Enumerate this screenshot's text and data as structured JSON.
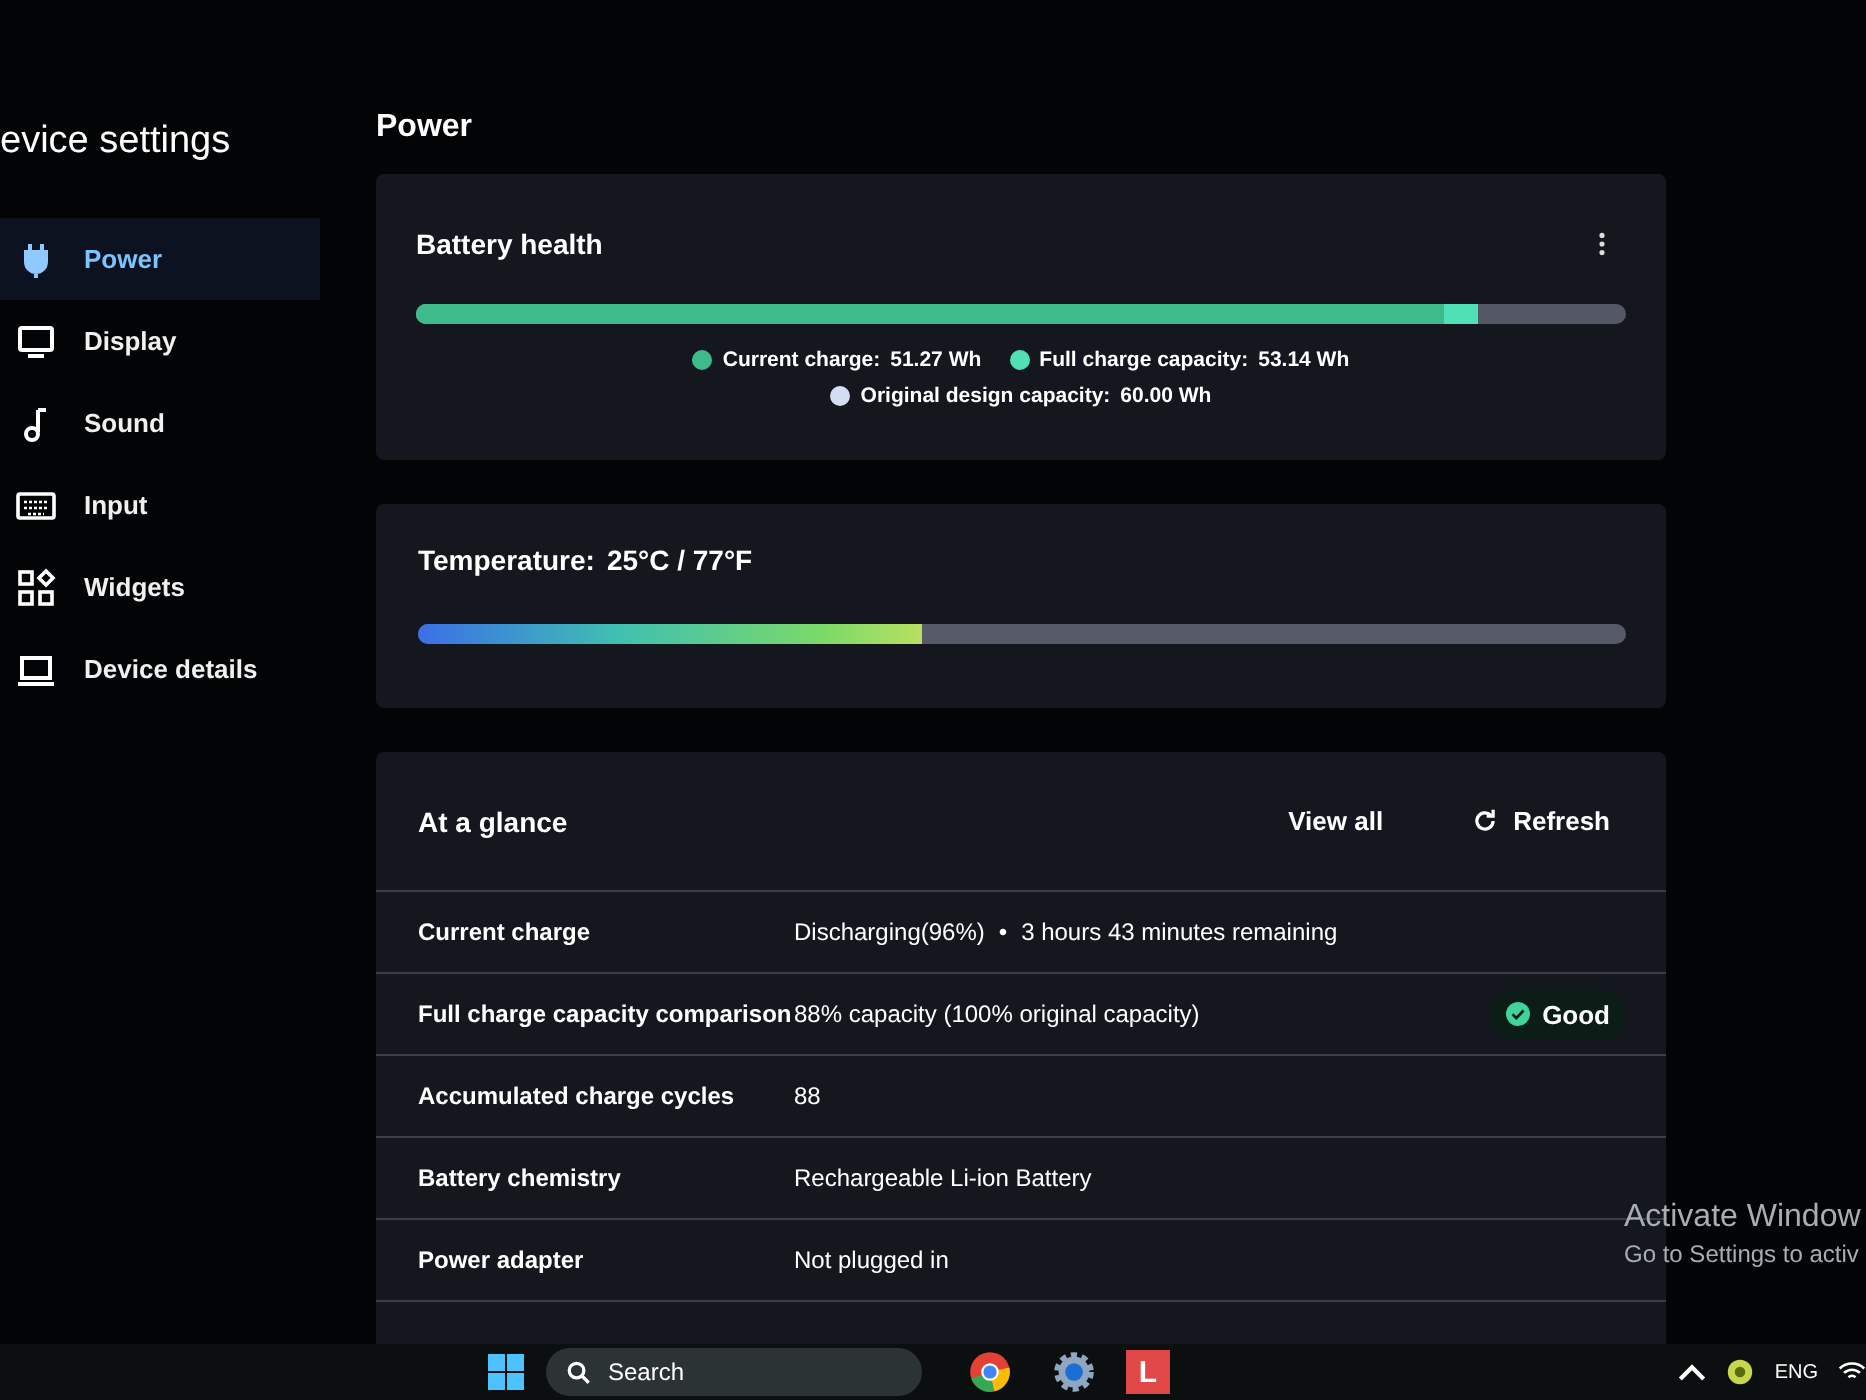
{
  "sidebar": {
    "title": "evice settings",
    "items": [
      {
        "label": "Power",
        "kind": "plug",
        "selected": true
      },
      {
        "label": "Display",
        "kind": "monitor",
        "selected": false
      },
      {
        "label": "Sound",
        "kind": "note",
        "selected": false
      },
      {
        "label": "Input",
        "kind": "keyboard",
        "selected": false
      },
      {
        "label": "Widgets",
        "kind": "widgets",
        "selected": false
      },
      {
        "label": "Device details",
        "kind": "laptop",
        "selected": false
      }
    ]
  },
  "page_title": "Power",
  "battery_health": {
    "title": "Battery health",
    "bar": [
      {
        "level": 0.878,
        "color": "#4fe0b5"
      },
      {
        "level": 0.85,
        "color": "#3dbb8a"
      }
    ],
    "legend": [
      {
        "label": "Current charge:",
        "value": "51.27 Wh",
        "color": "#3dbb8a"
      },
      {
        "label": "Full charge capacity:",
        "value": "53.14 Wh",
        "color": "#4fe0b5"
      },
      {
        "label": "Original design capacity:",
        "value": "60.00 Wh",
        "color": "#d3def2"
      }
    ]
  },
  "temperature": {
    "title": "Temperature:",
    "value": "25°C / 77°F",
    "level": 0.417
  },
  "at_a_glance": {
    "title": "At a glance",
    "actions": [
      {
        "label": "View all",
        "kind": "link"
      },
      {
        "label": "Refresh",
        "kind": "refresh"
      }
    ],
    "rows": [
      {
        "label": "Current charge",
        "values": [
          "Discharging(96%)",
          "•",
          "3 hours 43 minutes remaining"
        ]
      },
      {
        "label": "Full charge capacity comparison",
        "values": [
          "88% capacity (100% original capacity)"
        ],
        "badge": {
          "label": "Good",
          "kind": "good"
        }
      },
      {
        "label": "Accumulated charge cycles",
        "values": [
          "88"
        ]
      },
      {
        "label": "Battery chemistry",
        "values": [
          "Rechargeable Li-ion Battery"
        ]
      },
      {
        "label": "Power adapter",
        "values": [
          "Not plugged in"
        ]
      }
    ]
  },
  "activation_notice": {
    "title": "Activate Window",
    "subtitle": "Go to Settings to activ"
  },
  "taskbar": {
    "search": {
      "placeholder": "Search"
    },
    "apps": [
      {
        "kind": "browser"
      },
      {
        "kind": "settings"
      },
      {
        "kind": "letter",
        "label": "L"
      }
    ],
    "tray": {
      "language": "ENG"
    }
  }
}
